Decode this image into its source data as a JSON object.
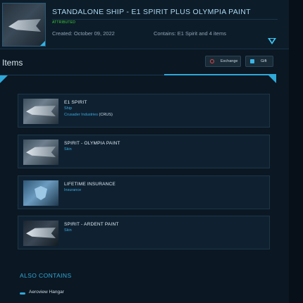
{
  "header": {
    "title": "STANDALONE SHIP - E1 SPIRIT PLUS OLYMPIA PAINT",
    "status": "ATTRIBUTED",
    "created": "Created: October 09, 2022",
    "contains": "Contains: E1 Spirit and 4 items"
  },
  "items_section": {
    "title": "Items",
    "exchange_label": "Exchange",
    "gift_label": "Gift"
  },
  "items": [
    {
      "name": "E1 SPIRIT",
      "type": "Ship",
      "manufacturer": "Crusader Industries",
      "manufacturer_code": "(CRUS)"
    },
    {
      "name": "SPIRIT - OLYMPIA PAINT",
      "type": "Skin"
    },
    {
      "name": "LIFETIME INSURANCE",
      "type": "Insurance"
    },
    {
      "name": "SPIRIT - ARDENT PAINT",
      "type": "Skin"
    }
  ],
  "also_contains": {
    "title": "ALSO CONTAINS",
    "entries": [
      "Aeroview Hangar"
    ]
  },
  "colors": {
    "accent": "#2fa8d8",
    "status_green": "#3ad03a",
    "exchange_icon": "#e04848"
  },
  "icons": [
    "expand-chevron-icon",
    "exchange-icon",
    "gift-icon"
  ]
}
